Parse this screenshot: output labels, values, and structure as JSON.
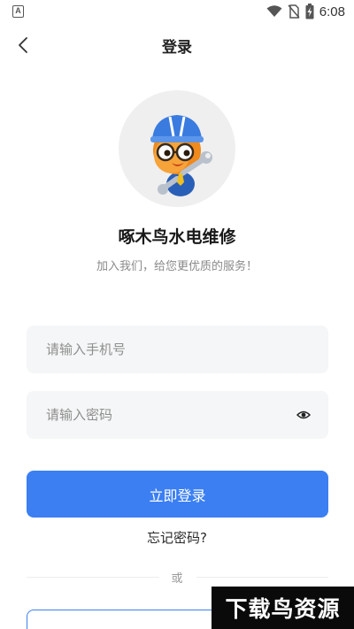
{
  "status_bar": {
    "app_icon_letter": "A",
    "time": "6:08",
    "icons": [
      "wifi-icon",
      "no-sim-icon",
      "battery-charging-icon"
    ]
  },
  "header": {
    "back_icon": "chevron-left-icon",
    "title": "登录"
  },
  "brand": {
    "avatar_icon": "woodpecker-mascot-icon",
    "app_name": "啄木鸟水电维修",
    "slogan": "加入我们，给您更优质的服务！"
  },
  "form": {
    "phone_placeholder": "请输入手机号",
    "phone_value": "",
    "password_placeholder": "请输入密码",
    "password_value": "",
    "password_toggle_icon": "eye-icon",
    "login_label": "立即登录",
    "forgot_label": "忘记密码?",
    "divider_label": "或"
  },
  "watermark": {
    "text": "下载鸟资源"
  },
  "colors": {
    "primary": "#3b7ff3",
    "input_bg": "#f5f6f7",
    "avatar_bg": "#efefef"
  }
}
